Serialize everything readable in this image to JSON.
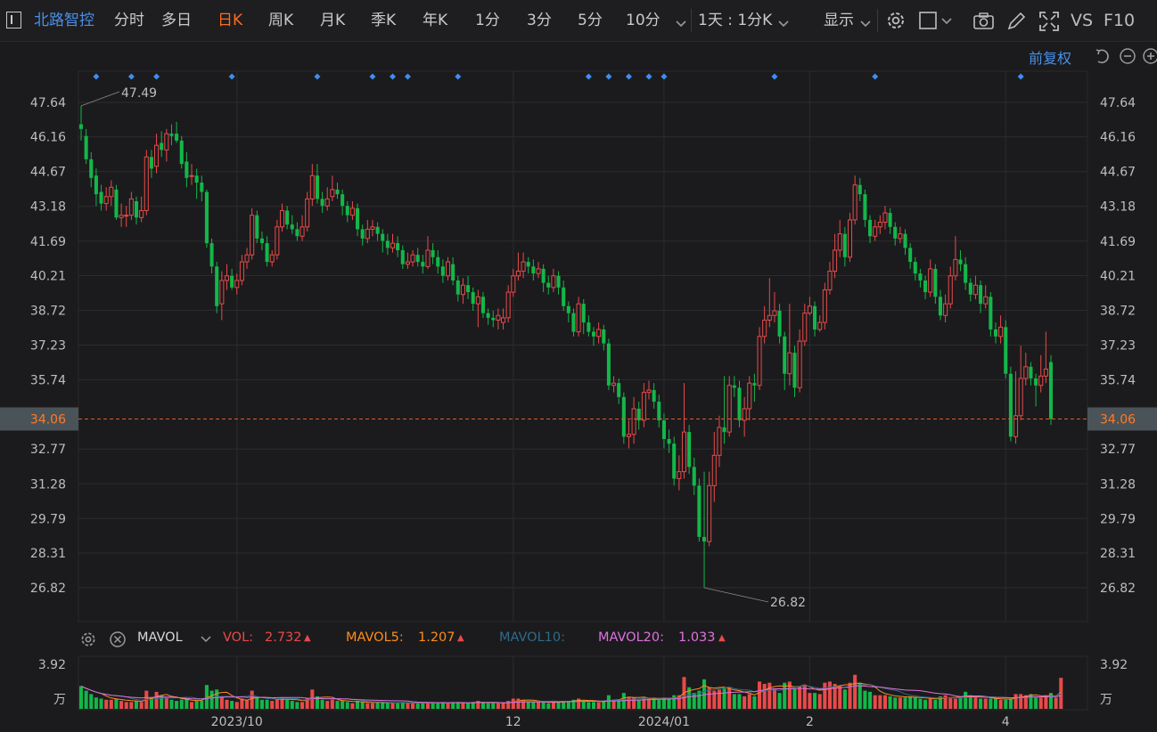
{
  "toolbar": {
    "stock_name": "北路智控",
    "periods": [
      "分时",
      "多日",
      "日K",
      "周K",
      "月K",
      "季K",
      "年K",
      "1分",
      "3分",
      "5分",
      "10分"
    ],
    "active_period": "日K",
    "combo": "1天 : 1分K",
    "display": "显示",
    "vs": "VS",
    "f10": "F10"
  },
  "adjust": {
    "label": "前复权"
  },
  "indicator": {
    "name": "MAVOL",
    "vol_label": "VOL:",
    "vol_value": "2.732",
    "ma5_label": "MAVOL5:",
    "ma5_value": "1.207",
    "ma10_label": "MAVOL10:",
    "ma20_label": "MAVOL20:",
    "ma20_value": "1.033",
    "up_arrow": "▲"
  },
  "colors": {
    "up": "#e84a4a",
    "down": "#13b749",
    "background": "#1b1b1d",
    "grid": "#2c2c2e",
    "current_price_line": "#e05a2b",
    "marker": "#3d8ef0",
    "ma5": "#ff8c1a",
    "ma10": "#2e6b8a",
    "ma20": "#e070e0",
    "active_tab": "#ff6a1f"
  },
  "chart_data": {
    "type": "candlestick",
    "y_ticks": [
      "47.64",
      "46.16",
      "44.67",
      "43.18",
      "41.69",
      "40.21",
      "38.72",
      "37.23",
      "35.74",
      "34.06",
      "32.77",
      "31.28",
      "29.79",
      "28.31",
      "26.82"
    ],
    "ylim": [
      26.82,
      47.64
    ],
    "current_price": "34.06",
    "max_label": "47.49",
    "min_label": "26.82",
    "x_labels": [
      "2023/10",
      "12",
      "2024/01",
      "2",
      "4"
    ],
    "volume_ticks": [
      "3.92",
      "万"
    ],
    "candles": [
      [
        46.7,
        46.5,
        47.49,
        46.0
      ],
      [
        46.2,
        45.2,
        46.5,
        45.0
      ],
      [
        45.2,
        44.4,
        45.5,
        44.0
      ],
      [
        44.5,
        43.7,
        44.8,
        43.2
      ],
      [
        43.8,
        43.3,
        44.1,
        43.0
      ],
      [
        43.3,
        43.6,
        44.0,
        43.0
      ],
      [
        43.6,
        44.0,
        44.3,
        43.2
      ],
      [
        43.9,
        42.7,
        44.1,
        42.6
      ],
      [
        42.7,
        42.8,
        43.3,
        42.3
      ],
      [
        42.8,
        42.8,
        43.2,
        42.3
      ],
      [
        42.8,
        43.5,
        43.8,
        42.6
      ],
      [
        43.4,
        42.7,
        43.6,
        42.4
      ],
      [
        42.7,
        43.0,
        43.6,
        42.5
      ],
      [
        43.0,
        45.3,
        45.6,
        42.8
      ],
      [
        45.3,
        44.8,
        45.6,
        44.4
      ],
      [
        44.9,
        45.8,
        46.3,
        44.6
      ],
      [
        45.9,
        45.6,
        46.4,
        45.3
      ],
      [
        45.6,
        46.3,
        46.5,
        45.1
      ],
      [
        46.3,
        46.2,
        46.7,
        45.8
      ],
      [
        46.3,
        46.0,
        46.8,
        45.9
      ],
      [
        46.0,
        45.0,
        46.2,
        44.8
      ],
      [
        45.1,
        44.4,
        45.5,
        44.0
      ],
      [
        44.5,
        44.5,
        45.0,
        44.1
      ],
      [
        44.5,
        44.2,
        44.8,
        43.5
      ],
      [
        44.2,
        43.8,
        44.5,
        43.4
      ],
      [
        43.8,
        41.6,
        43.9,
        41.4
      ],
      [
        41.6,
        40.6,
        41.8,
        40.3
      ],
      [
        40.6,
        38.9,
        40.8,
        38.6
      ],
      [
        39.0,
        40.0,
        40.4,
        38.3
      ],
      [
        40.0,
        40.2,
        40.7,
        39.6
      ],
      [
        40.2,
        39.7,
        40.5,
        39.6
      ],
      [
        39.7,
        40.0,
        40.3,
        39.4
      ],
      [
        40.0,
        40.8,
        41.1,
        39.8
      ],
      [
        40.8,
        41.1,
        41.4,
        40.5
      ],
      [
        41.1,
        42.8,
        43.1,
        40.9
      ],
      [
        42.8,
        41.8,
        43.0,
        41.6
      ],
      [
        41.8,
        41.6,
        42.1,
        41.3
      ],
      [
        41.6,
        40.8,
        41.9,
        40.6
      ],
      [
        40.8,
        41.1,
        41.3,
        40.6
      ],
      [
        41.1,
        42.3,
        42.6,
        40.9
      ],
      [
        42.3,
        43.0,
        43.3,
        42.1
      ],
      [
        43.0,
        42.4,
        43.2,
        42.2
      ],
      [
        42.4,
        42.2,
        42.8,
        42.0
      ],
      [
        42.2,
        41.9,
        42.5,
        41.7
      ],
      [
        41.9,
        42.3,
        42.8,
        41.7
      ],
      [
        42.3,
        43.5,
        43.8,
        42.1
      ],
      [
        43.5,
        44.5,
        45.0,
        43.2
      ],
      [
        44.5,
        43.5,
        45.0,
        43.3
      ],
      [
        43.5,
        43.2,
        43.8,
        42.9
      ],
      [
        43.2,
        43.5,
        44.0,
        43.0
      ],
      [
        43.6,
        43.9,
        44.5,
        43.4
      ],
      [
        43.9,
        43.7,
        44.2,
        43.5
      ],
      [
        43.7,
        43.2,
        43.9,
        42.8
      ],
      [
        43.2,
        42.8,
        43.4,
        42.5
      ],
      [
        42.8,
        43.1,
        43.4,
        42.6
      ],
      [
        43.1,
        42.2,
        43.3,
        41.9
      ],
      [
        42.2,
        41.8,
        42.4,
        41.5
      ],
      [
        41.8,
        42.2,
        42.6,
        41.6
      ],
      [
        42.2,
        42.3,
        42.6,
        41.9
      ],
      [
        42.3,
        42.0,
        42.5,
        41.7
      ],
      [
        42.0,
        41.7,
        42.2,
        41.2
      ],
      [
        41.7,
        41.4,
        42.0,
        41.1
      ],
      [
        41.4,
        41.6,
        42.0,
        41.2
      ],
      [
        41.6,
        41.3,
        41.9,
        41.0
      ],
      [
        41.3,
        40.7,
        41.5,
        40.5
      ],
      [
        40.7,
        40.8,
        41.2,
        40.5
      ],
      [
        40.8,
        41.1,
        41.3,
        40.6
      ],
      [
        41.1,
        40.8,
        41.4,
        40.6
      ],
      [
        40.8,
        40.6,
        41.1,
        40.3
      ],
      [
        40.6,
        41.3,
        41.9,
        40.5
      ],
      [
        41.3,
        41.0,
        41.6,
        40.7
      ],
      [
        41.0,
        40.6,
        41.3,
        40.3
      ],
      [
        40.6,
        40.2,
        40.9,
        39.9
      ],
      [
        40.2,
        40.8,
        41.0,
        40.0
      ],
      [
        40.7,
        40.0,
        41.0,
        39.8
      ],
      [
        40.0,
        39.4,
        40.2,
        39.1
      ],
      [
        39.4,
        39.8,
        40.1,
        39.0
      ],
      [
        39.8,
        39.5,
        40.2,
        39.2
      ],
      [
        39.5,
        39.0,
        39.7,
        38.7
      ],
      [
        39.0,
        39.3,
        39.6,
        38.0
      ],
      [
        39.3,
        38.6,
        39.5,
        38.4
      ],
      [
        38.6,
        38.4,
        38.8,
        38.1
      ],
      [
        38.4,
        38.3,
        38.7,
        38.0
      ],
      [
        38.3,
        38.5,
        38.8,
        37.9
      ],
      [
        38.2,
        38.4,
        38.8,
        37.9
      ],
      [
        38.4,
        39.5,
        39.8,
        38.2
      ],
      [
        39.5,
        40.2,
        40.5,
        39.3
      ],
      [
        40.2,
        40.4,
        41.2,
        40.0
      ],
      [
        40.4,
        40.8,
        41.2,
        40.1
      ],
      [
        40.8,
        40.6,
        41.0,
        40.3
      ],
      [
        40.6,
        40.3,
        40.9,
        40.0
      ],
      [
        40.3,
        40.5,
        40.8,
        40.1
      ],
      [
        40.5,
        39.9,
        40.7,
        39.5
      ],
      [
        39.9,
        39.7,
        40.2,
        39.4
      ],
      [
        39.7,
        40.2,
        40.5,
        39.5
      ],
      [
        40.2,
        39.7,
        40.4,
        39.4
      ],
      [
        39.7,
        38.9,
        40.0,
        38.7
      ],
      [
        38.9,
        38.6,
        39.1,
        38.2
      ],
      [
        38.6,
        37.8,
        38.8,
        37.6
      ],
      [
        37.8,
        39.0,
        39.3,
        37.6
      ],
      [
        39.0,
        38.2,
        39.2,
        37.7
      ],
      [
        38.2,
        37.8,
        38.5,
        37.6
      ],
      [
        37.8,
        37.6,
        38.0,
        37.2
      ],
      [
        37.6,
        37.9,
        38.2,
        37.3
      ],
      [
        37.9,
        37.3,
        38.1,
        37.0
      ],
      [
        37.3,
        35.5,
        37.5,
        35.3
      ],
      [
        35.5,
        35.6,
        35.9,
        35.2
      ],
      [
        35.6,
        35.0,
        35.8,
        34.7
      ],
      [
        35.0,
        33.3,
        35.2,
        33.0
      ],
      [
        33.3,
        33.4,
        34.0,
        32.8
      ],
      [
        33.4,
        34.5,
        35.0,
        33.0
      ],
      [
        34.5,
        34.0,
        34.8,
        33.6
      ],
      [
        34.0,
        35.2,
        35.6,
        33.7
      ],
      [
        35.2,
        35.3,
        35.7,
        34.9
      ],
      [
        35.3,
        34.8,
        35.6,
        34.5
      ],
      [
        34.8,
        34.0,
        35.1,
        33.7
      ],
      [
        34.0,
        33.2,
        34.3,
        32.8
      ],
      [
        33.2,
        33.0,
        33.6,
        32.6
      ],
      [
        33.0,
        31.5,
        33.3,
        31.2
      ],
      [
        31.5,
        31.8,
        32.5,
        31.0
      ],
      [
        31.8,
        33.5,
        35.6,
        31.5
      ],
      [
        33.5,
        32.0,
        33.8,
        31.7
      ],
      [
        32.0,
        31.2,
        32.4,
        30.8
      ],
      [
        31.2,
        29.0,
        31.5,
        28.8
      ],
      [
        29.0,
        28.8,
        31.8,
        26.82
      ],
      [
        28.8,
        31.2,
        31.8,
        28.6
      ],
      [
        31.2,
        32.5,
        33.5,
        30.5
      ],
      [
        32.5,
        33.7,
        34.2,
        32.0
      ],
      [
        33.7,
        33.5,
        35.9,
        33.0
      ],
      [
        33.5,
        35.5,
        35.9,
        33.3
      ],
      [
        35.5,
        35.4,
        35.9,
        35.0
      ],
      [
        35.4,
        34.0,
        35.7,
        33.7
      ],
      [
        34.0,
        34.5,
        35.0,
        33.3
      ],
      [
        34.5,
        35.6,
        35.9,
        34.0
      ],
      [
        35.6,
        35.5,
        36.0,
        34.8
      ],
      [
        35.5,
        37.6,
        38.0,
        35.3
      ],
      [
        37.6,
        38.3,
        38.9,
        37.3
      ],
      [
        38.3,
        38.5,
        40.1,
        38.0
      ],
      [
        38.5,
        38.7,
        39.5,
        38.2
      ],
      [
        38.7,
        37.6,
        39.0,
        37.3
      ],
      [
        37.6,
        36.0,
        37.8,
        35.3
      ],
      [
        36.0,
        36.9,
        39.0,
        35.5
      ],
      [
        36.9,
        35.4,
        37.2,
        35.0
      ],
      [
        35.4,
        37.4,
        37.9,
        35.2
      ],
      [
        37.4,
        38.6,
        39.0,
        37.2
      ],
      [
        38.6,
        38.9,
        39.3,
        38.5
      ],
      [
        38.9,
        37.9,
        39.1,
        37.6
      ],
      [
        37.9,
        38.2,
        38.5,
        37.8
      ],
      [
        38.2,
        39.6,
        39.9,
        37.9
      ],
      [
        39.6,
        40.4,
        40.8,
        39.4
      ],
      [
        40.4,
        41.3,
        42.0,
        40.1
      ],
      [
        41.3,
        42.0,
        42.6,
        41.0
      ],
      [
        42.0,
        41.0,
        42.3,
        40.6
      ],
      [
        41.0,
        42.6,
        42.9,
        40.8
      ],
      [
        42.6,
        44.1,
        44.5,
        42.4
      ],
      [
        44.1,
        43.7,
        44.4,
        43.4
      ],
      [
        43.7,
        42.6,
        43.9,
        42.3
      ],
      [
        42.6,
        41.9,
        42.8,
        41.6
      ],
      [
        41.9,
        42.3,
        42.6,
        41.7
      ],
      [
        42.3,
        42.5,
        42.8,
        42.0
      ],
      [
        42.5,
        42.9,
        43.2,
        42.2
      ],
      [
        42.9,
        42.3,
        43.1,
        42.0
      ],
      [
        42.3,
        41.8,
        42.5,
        41.5
      ],
      [
        41.8,
        42.0,
        42.3,
        41.6
      ],
      [
        42.0,
        41.4,
        42.2,
        41.1
      ],
      [
        41.4,
        40.8,
        41.6,
        40.5
      ],
      [
        40.8,
        40.3,
        41.0,
        40.0
      ],
      [
        40.3,
        40.0,
        40.5,
        39.7
      ],
      [
        40.0,
        39.5,
        40.2,
        39.2
      ],
      [
        39.5,
        40.5,
        40.9,
        39.3
      ],
      [
        40.5,
        39.3,
        40.7,
        39.0
      ],
      [
        39.3,
        38.5,
        39.6,
        38.3
      ],
      [
        38.5,
        39.0,
        39.4,
        38.2
      ],
      [
        39.0,
        40.2,
        40.6,
        38.8
      ],
      [
        40.2,
        40.9,
        41.9,
        40.0
      ],
      [
        40.9,
        40.7,
        41.3,
        40.4
      ],
      [
        40.7,
        39.9,
        41.0,
        39.6
      ],
      [
        39.9,
        39.4,
        40.1,
        39.1
      ],
      [
        39.4,
        39.8,
        40.2,
        39.2
      ],
      [
        39.8,
        39.0,
        40.0,
        38.6
      ],
      [
        39.0,
        39.3,
        39.8,
        38.8
      ],
      [
        39.3,
        37.9,
        39.5,
        37.6
      ],
      [
        37.9,
        37.6,
        38.2,
        37.3
      ],
      [
        37.6,
        38.0,
        38.5,
        37.3
      ],
      [
        38.0,
        36.0,
        38.3,
        35.8
      ],
      [
        36.0,
        33.3,
        36.3,
        33.1
      ],
      [
        33.3,
        34.2,
        36.1,
        33.0
      ],
      [
        34.2,
        35.8,
        37.2,
        34.0
      ],
      [
        35.8,
        36.3,
        36.9,
        35.5
      ],
      [
        36.3,
        35.8,
        36.5,
        35.5
      ],
      [
        35.8,
        35.5,
        36.0,
        34.6
      ],
      [
        35.5,
        35.9,
        36.8,
        35.2
      ],
      [
        35.9,
        36.2,
        37.8,
        35.6
      ],
      [
        36.5,
        34.06,
        36.8,
        33.8
      ]
    ],
    "volumes": [
      2.0,
      1.6,
      1.3,
      1.0,
      0.9,
      0.8,
      0.8,
      0.9,
      0.7,
      0.6,
      0.6,
      0.7,
      0.6,
      1.6,
      1.0,
      1.5,
      1.2,
      1.0,
      0.8,
      0.7,
      0.8,
      0.9,
      0.6,
      0.7,
      0.7,
      2.1,
      1.6,
      1.7,
      1.1,
      0.8,
      0.7,
      0.6,
      0.9,
      0.8,
      1.6,
      1.0,
      0.8,
      0.8,
      0.7,
      0.9,
      1.0,
      0.8,
      0.7,
      0.6,
      0.6,
      0.9,
      1.7,
      1.1,
      0.8,
      0.7,
      0.8,
      0.7,
      0.7,
      0.6,
      0.5,
      0.7,
      0.6,
      0.5,
      0.5,
      0.6,
      0.6,
      0.5,
      0.5,
      0.5,
      0.6,
      0.5,
      0.5,
      0.5,
      0.5,
      0.6,
      0.5,
      0.5,
      0.6,
      0.5,
      0.6,
      0.6,
      0.5,
      0.5,
      0.6,
      0.7,
      0.6,
      0.5,
      0.5,
      0.5,
      0.5,
      0.7,
      0.9,
      0.9,
      0.8,
      0.6,
      0.6,
      0.6,
      0.6,
      0.5,
      0.6,
      0.6,
      0.7,
      0.7,
      0.8,
      0.9,
      0.7,
      0.6,
      0.6,
      0.6,
      0.6,
      1.2,
      0.8,
      0.8,
      1.4,
      1.0,
      1.0,
      0.8,
      1.0,
      0.9,
      0.8,
      0.8,
      1.0,
      0.9,
      1.2,
      1.2,
      2.8,
      1.9,
      1.4,
      1.6,
      2.6,
      1.9,
      1.6,
      1.7,
      1.8,
      1.9,
      1.3,
      1.3,
      1.1,
      1.3,
      1.1,
      2.4,
      2.2,
      2.3,
      1.8,
      1.4,
      2.3,
      2.4,
      1.8,
      2.0,
      2.1,
      1.4,
      1.4,
      1.3,
      2.3,
      2.4,
      2.2,
      2.0,
      1.7,
      2.3,
      3.0,
      2.3,
      1.6,
      1.5,
      1.2,
      1.2,
      1.2,
      1.1,
      1.0,
      1.0,
      1.0,
      1.1,
      1.0,
      0.9,
      0.8,
      0.9,
      0.8,
      1.1,
      1.2,
      1.0,
      0.9,
      1.1,
      1.5,
      1.2,
      1.0,
      0.9,
      0.9,
      0.9,
      0.9,
      0.8,
      0.8,
      0.9,
      1.3,
      1.3,
      1.2,
      1.3,
      1.0,
      1.0,
      1.2,
      1.4,
      1.0,
      2.732
    ],
    "markers_count": 29
  }
}
